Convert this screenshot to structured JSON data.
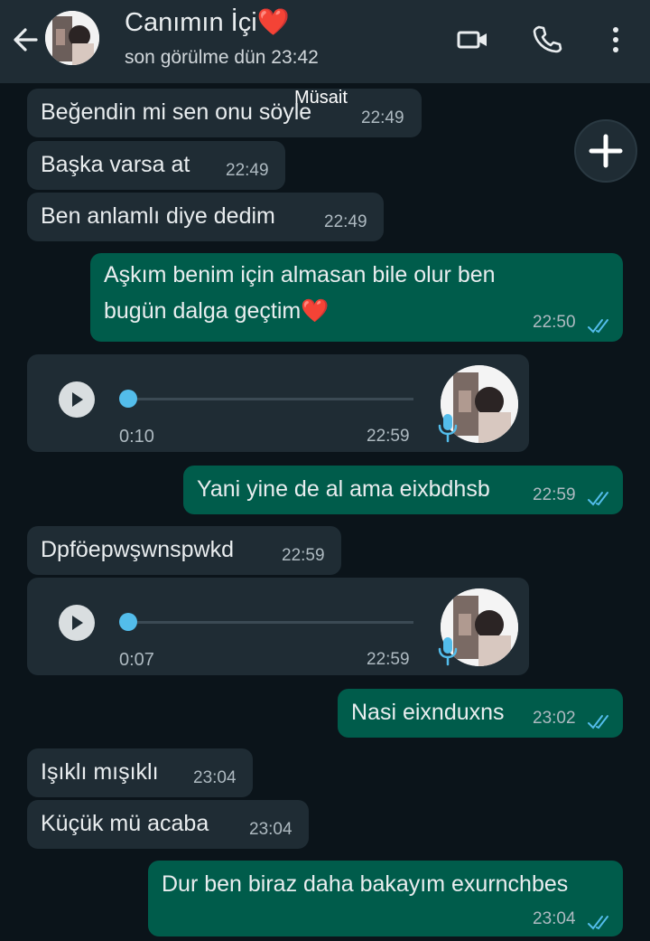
{
  "header": {
    "title": "Canımın İçi❤️",
    "status": "son görülme dün 23:42"
  },
  "banner": "Müsait",
  "messages": [
    {
      "dir": "in",
      "text": "Beğendin mi sen onu söyle",
      "time": "22:49"
    },
    {
      "dir": "in",
      "text": "Başka varsa at",
      "time": "22:49"
    },
    {
      "dir": "in",
      "text": "Ben anlamlı diye dedim",
      "time": "22:49"
    },
    {
      "dir": "out",
      "line1": "Aşkım benim için almasan bile olur ben",
      "line2": "bugün dalga geçtim❤️",
      "time": "22:50",
      "read": true
    },
    {
      "dir": "in",
      "type": "voice",
      "duration": "0:10",
      "time": "22:59"
    },
    {
      "dir": "out",
      "text": "Yani yine de al ama eixbdhsb",
      "time": "22:59",
      "read": true
    },
    {
      "dir": "in",
      "text": "Dpföepwşwnspwkd",
      "time": "22:59"
    },
    {
      "dir": "in",
      "type": "voice",
      "duration": "0:07",
      "time": "22:59"
    },
    {
      "dir": "out",
      "text": "Nasi eixnduxns",
      "time": "23:02",
      "read": true
    },
    {
      "dir": "in",
      "text": "Işıklı mışıklı",
      "time": "23:04"
    },
    {
      "dir": "in",
      "text": "Küçük mü acaba",
      "time": "23:04"
    },
    {
      "dir": "out",
      "text": "Dur ben biraz daha bakayım exurnchbes",
      "time": "23:04",
      "read": true
    }
  ],
  "colors": {
    "background": "#0b141a",
    "incoming_bubble": "#1f2c34",
    "outgoing_bubble": "#005c4b",
    "read_ticks": "#53bdeb"
  },
  "icons": [
    "back-arrow-icon",
    "video-call-icon",
    "voice-call-icon",
    "more-options-icon",
    "plus-icon",
    "play-icon",
    "mic-icon",
    "double-check-icon"
  ]
}
